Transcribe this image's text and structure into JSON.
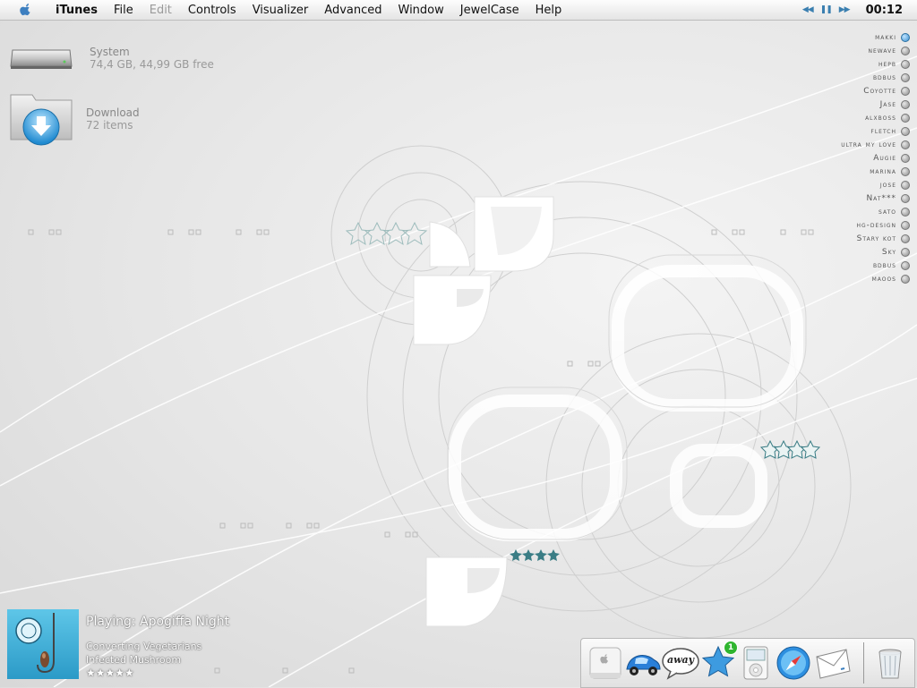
{
  "menubar": {
    "app_name": "iTunes",
    "items": [
      "File",
      "Edit",
      "Controls",
      "Visualizer",
      "Advanced",
      "Window",
      "JewelCase",
      "Help"
    ],
    "disabled_item": "Edit",
    "clock": "00:12",
    "controls_icons": [
      "rewind-icon",
      "pause-icon",
      "fast-forward-icon"
    ]
  },
  "desktop": {
    "drive": {
      "name": "System",
      "info": "74,4 GB, 44,99 GB free"
    },
    "folder": {
      "name": "Download",
      "info": "72 items"
    }
  },
  "buddies": [
    {
      "name": "makki",
      "online": true
    },
    {
      "name": "newave",
      "online": false
    },
    {
      "name": "hepb",
      "online": false
    },
    {
      "name": "bdbus",
      "online": false
    },
    {
      "name": "Coyotte",
      "online": false
    },
    {
      "name": "Jase",
      "online": false
    },
    {
      "name": "alxboss",
      "online": false
    },
    {
      "name": "fletch",
      "online": false
    },
    {
      "name": "ultra my love",
      "online": false
    },
    {
      "name": "Augie",
      "online": false
    },
    {
      "name": "marina",
      "online": false
    },
    {
      "name": "jose",
      "online": false
    },
    {
      "name": "Nat***",
      "online": false
    },
    {
      "name": "sato",
      "online": false
    },
    {
      "name": "hg-design",
      "online": false
    },
    {
      "name": "Stary kot",
      "online": false
    },
    {
      "name": "Sky",
      "online": false
    },
    {
      "name": "bdbus",
      "online": false
    },
    {
      "name": "maoos",
      "online": false
    }
  ],
  "now_playing": {
    "title": "Playing: Apogiffa Night",
    "album": "Converting Vegetarians",
    "artist": "Infected Mushroom",
    "rating": 5,
    "stars": "★★★★★"
  },
  "dock": {
    "icons": [
      "finder-icon",
      "beetle-car-icon",
      "away-chat-icon",
      "star-favorites-icon",
      "ipod-icon",
      "safari-icon",
      "mail-icon",
      "trash-icon"
    ],
    "away_label": "away",
    "badge": "1"
  },
  "colors": {
    "accent": "#3a8fd0",
    "teal_stars": "#3a7d85"
  }
}
